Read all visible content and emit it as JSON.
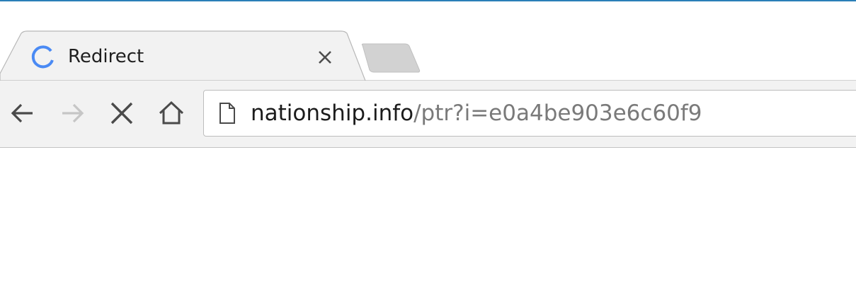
{
  "window": {
    "top_cut_text_left": "",
    "top_cut_text_right": ""
  },
  "tab": {
    "title": "Redirect",
    "favicon": "loading-spinner-icon",
    "close_icon": "close-icon"
  },
  "toolbar": {
    "back_icon": "back-arrow-icon",
    "forward_icon": "forward-arrow-icon",
    "stop_icon": "stop-icon",
    "home_icon": "home-icon"
  },
  "omnibox": {
    "page_icon": "page-icon",
    "url_host": "nationship.info",
    "url_path": "/ptr?i=e0a4be903e6c60f9"
  },
  "colors": {
    "accent": "#2a7fb8",
    "spinner": "#4a8af4",
    "toolbar_bg": "#f2f2f2",
    "inactive_tab": "#d2d2d2"
  }
}
